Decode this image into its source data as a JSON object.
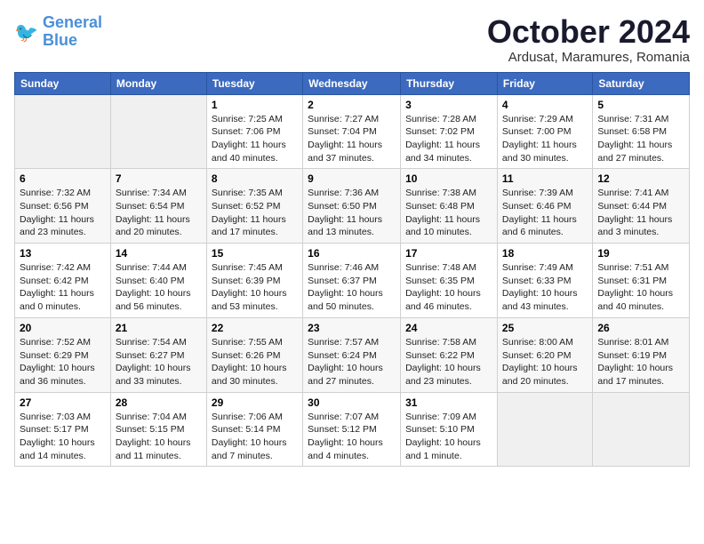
{
  "logo": {
    "line1": "General",
    "line2": "Blue"
  },
  "title": "October 2024",
  "subtitle": "Ardusat, Maramures, Romania",
  "headers": [
    "Sunday",
    "Monday",
    "Tuesday",
    "Wednesday",
    "Thursday",
    "Friday",
    "Saturday"
  ],
  "weeks": [
    [
      {
        "num": "",
        "sunrise": "",
        "sunset": "",
        "daylight": ""
      },
      {
        "num": "",
        "sunrise": "",
        "sunset": "",
        "daylight": ""
      },
      {
        "num": "1",
        "sunrise": "Sunrise: 7:25 AM",
        "sunset": "Sunset: 7:06 PM",
        "daylight": "Daylight: 11 hours and 40 minutes."
      },
      {
        "num": "2",
        "sunrise": "Sunrise: 7:27 AM",
        "sunset": "Sunset: 7:04 PM",
        "daylight": "Daylight: 11 hours and 37 minutes."
      },
      {
        "num": "3",
        "sunrise": "Sunrise: 7:28 AM",
        "sunset": "Sunset: 7:02 PM",
        "daylight": "Daylight: 11 hours and 34 minutes."
      },
      {
        "num": "4",
        "sunrise": "Sunrise: 7:29 AM",
        "sunset": "Sunset: 7:00 PM",
        "daylight": "Daylight: 11 hours and 30 minutes."
      },
      {
        "num": "5",
        "sunrise": "Sunrise: 7:31 AM",
        "sunset": "Sunset: 6:58 PM",
        "daylight": "Daylight: 11 hours and 27 minutes."
      }
    ],
    [
      {
        "num": "6",
        "sunrise": "Sunrise: 7:32 AM",
        "sunset": "Sunset: 6:56 PM",
        "daylight": "Daylight: 11 hours and 23 minutes."
      },
      {
        "num": "7",
        "sunrise": "Sunrise: 7:34 AM",
        "sunset": "Sunset: 6:54 PM",
        "daylight": "Daylight: 11 hours and 20 minutes."
      },
      {
        "num": "8",
        "sunrise": "Sunrise: 7:35 AM",
        "sunset": "Sunset: 6:52 PM",
        "daylight": "Daylight: 11 hours and 17 minutes."
      },
      {
        "num": "9",
        "sunrise": "Sunrise: 7:36 AM",
        "sunset": "Sunset: 6:50 PM",
        "daylight": "Daylight: 11 hours and 13 minutes."
      },
      {
        "num": "10",
        "sunrise": "Sunrise: 7:38 AM",
        "sunset": "Sunset: 6:48 PM",
        "daylight": "Daylight: 11 hours and 10 minutes."
      },
      {
        "num": "11",
        "sunrise": "Sunrise: 7:39 AM",
        "sunset": "Sunset: 6:46 PM",
        "daylight": "Daylight: 11 hours and 6 minutes."
      },
      {
        "num": "12",
        "sunrise": "Sunrise: 7:41 AM",
        "sunset": "Sunset: 6:44 PM",
        "daylight": "Daylight: 11 hours and 3 minutes."
      }
    ],
    [
      {
        "num": "13",
        "sunrise": "Sunrise: 7:42 AM",
        "sunset": "Sunset: 6:42 PM",
        "daylight": "Daylight: 11 hours and 0 minutes."
      },
      {
        "num": "14",
        "sunrise": "Sunrise: 7:44 AM",
        "sunset": "Sunset: 6:40 PM",
        "daylight": "Daylight: 10 hours and 56 minutes."
      },
      {
        "num": "15",
        "sunrise": "Sunrise: 7:45 AM",
        "sunset": "Sunset: 6:39 PM",
        "daylight": "Daylight: 10 hours and 53 minutes."
      },
      {
        "num": "16",
        "sunrise": "Sunrise: 7:46 AM",
        "sunset": "Sunset: 6:37 PM",
        "daylight": "Daylight: 10 hours and 50 minutes."
      },
      {
        "num": "17",
        "sunrise": "Sunrise: 7:48 AM",
        "sunset": "Sunset: 6:35 PM",
        "daylight": "Daylight: 10 hours and 46 minutes."
      },
      {
        "num": "18",
        "sunrise": "Sunrise: 7:49 AM",
        "sunset": "Sunset: 6:33 PM",
        "daylight": "Daylight: 10 hours and 43 minutes."
      },
      {
        "num": "19",
        "sunrise": "Sunrise: 7:51 AM",
        "sunset": "Sunset: 6:31 PM",
        "daylight": "Daylight: 10 hours and 40 minutes."
      }
    ],
    [
      {
        "num": "20",
        "sunrise": "Sunrise: 7:52 AM",
        "sunset": "Sunset: 6:29 PM",
        "daylight": "Daylight: 10 hours and 36 minutes."
      },
      {
        "num": "21",
        "sunrise": "Sunrise: 7:54 AM",
        "sunset": "Sunset: 6:27 PM",
        "daylight": "Daylight: 10 hours and 33 minutes."
      },
      {
        "num": "22",
        "sunrise": "Sunrise: 7:55 AM",
        "sunset": "Sunset: 6:26 PM",
        "daylight": "Daylight: 10 hours and 30 minutes."
      },
      {
        "num": "23",
        "sunrise": "Sunrise: 7:57 AM",
        "sunset": "Sunset: 6:24 PM",
        "daylight": "Daylight: 10 hours and 27 minutes."
      },
      {
        "num": "24",
        "sunrise": "Sunrise: 7:58 AM",
        "sunset": "Sunset: 6:22 PM",
        "daylight": "Daylight: 10 hours and 23 minutes."
      },
      {
        "num": "25",
        "sunrise": "Sunrise: 8:00 AM",
        "sunset": "Sunset: 6:20 PM",
        "daylight": "Daylight: 10 hours and 20 minutes."
      },
      {
        "num": "26",
        "sunrise": "Sunrise: 8:01 AM",
        "sunset": "Sunset: 6:19 PM",
        "daylight": "Daylight: 10 hours and 17 minutes."
      }
    ],
    [
      {
        "num": "27",
        "sunrise": "Sunrise: 7:03 AM",
        "sunset": "Sunset: 5:17 PM",
        "daylight": "Daylight: 10 hours and 14 minutes."
      },
      {
        "num": "28",
        "sunrise": "Sunrise: 7:04 AM",
        "sunset": "Sunset: 5:15 PM",
        "daylight": "Daylight: 10 hours and 11 minutes."
      },
      {
        "num": "29",
        "sunrise": "Sunrise: 7:06 AM",
        "sunset": "Sunset: 5:14 PM",
        "daylight": "Daylight: 10 hours and 7 minutes."
      },
      {
        "num": "30",
        "sunrise": "Sunrise: 7:07 AM",
        "sunset": "Sunset: 5:12 PM",
        "daylight": "Daylight: 10 hours and 4 minutes."
      },
      {
        "num": "31",
        "sunrise": "Sunrise: 7:09 AM",
        "sunset": "Sunset: 5:10 PM",
        "daylight": "Daylight: 10 hours and 1 minute."
      },
      {
        "num": "",
        "sunrise": "",
        "sunset": "",
        "daylight": ""
      },
      {
        "num": "",
        "sunrise": "",
        "sunset": "",
        "daylight": ""
      }
    ]
  ]
}
